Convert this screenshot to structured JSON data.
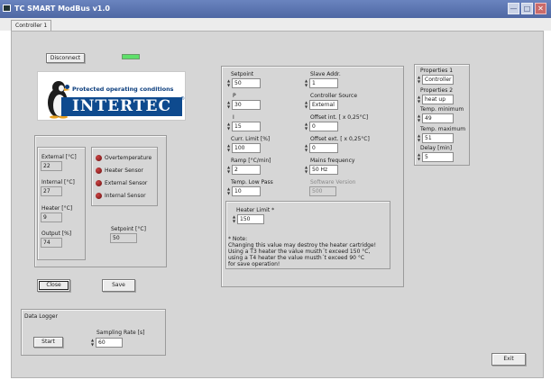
{
  "window": {
    "title": "TC SMART ModBus v1.0",
    "minimize_icon": "minimize-icon",
    "maximize_icon": "maximize-icon",
    "close_icon": "close-icon"
  },
  "tabs": [
    {
      "label": "Controller 1"
    }
  ],
  "connection": {
    "button_label": "Disconnect",
    "status_color": "#5ee06a"
  },
  "logo": {
    "tagline": "Protected operating conditions",
    "wordmark": "INTERTEC",
    "mark": "®"
  },
  "status": {
    "readings": [
      {
        "label": "External [°C]",
        "value": "22"
      },
      {
        "label": "Internal [°C]",
        "value": "27"
      },
      {
        "label": "Heater [°C]",
        "value": "9"
      },
      {
        "label": "Output [%]",
        "value": "74"
      }
    ],
    "alarms": [
      {
        "label": "Overtemperature"
      },
      {
        "label": "Heater Sensor"
      },
      {
        "label": "External Sensor"
      },
      {
        "label": "Internal Sensor"
      }
    ],
    "setpoint_label": "Setpoint [°C]",
    "setpoint_value": "50"
  },
  "actions": {
    "close_label": "Close",
    "save_label": "Save",
    "exit_label": "Exit"
  },
  "data_logger": {
    "title": "Data Logger",
    "start_label": "Start",
    "rate_label": "Sampling Rate [s]",
    "rate_value": "60"
  },
  "params": {
    "left": [
      {
        "label": "Setpoint",
        "value": "50"
      },
      {
        "label": "P",
        "value": "30"
      },
      {
        "label": "I",
        "value": "15"
      },
      {
        "label": "Curr. Limit [%]",
        "value": "100"
      },
      {
        "label": "Ramp [°C/min]",
        "value": "2"
      },
      {
        "label": "Temp. Low Pass",
        "value": "10"
      }
    ],
    "right": [
      {
        "label": "Slave Addr.",
        "value": "1"
      },
      {
        "label": "Controller Source",
        "value": "External"
      },
      {
        "label": "Offset int. [ x 0,25°C]",
        "value": "0"
      },
      {
        "label": "Offset ext. [ x 0,25°C]",
        "value": "0"
      },
      {
        "label": "Mains frequency",
        "value": "50 Hz"
      }
    ],
    "software_label": "Software Version",
    "software_value": "500"
  },
  "heater": {
    "label": "Heater Limit *",
    "value": "150",
    "note": [
      "* Note:",
      "Changing this value may destroy the heater cartridge!",
      "Using a T3 heater the value musth´t exceed 150 °C,",
      "using a T4 heater the value musth´t exceed  90 °C",
      "for save operation!"
    ]
  },
  "properties": [
    {
      "label": "Properties 1",
      "value": "Controller"
    },
    {
      "label": "Properties 2",
      "value": "heat up"
    },
    {
      "label": "Temp. minimum",
      "value": "49"
    },
    {
      "label": "Temp. maximum",
      "value": "51"
    },
    {
      "label": "Delay [min]",
      "value": "5"
    }
  ]
}
